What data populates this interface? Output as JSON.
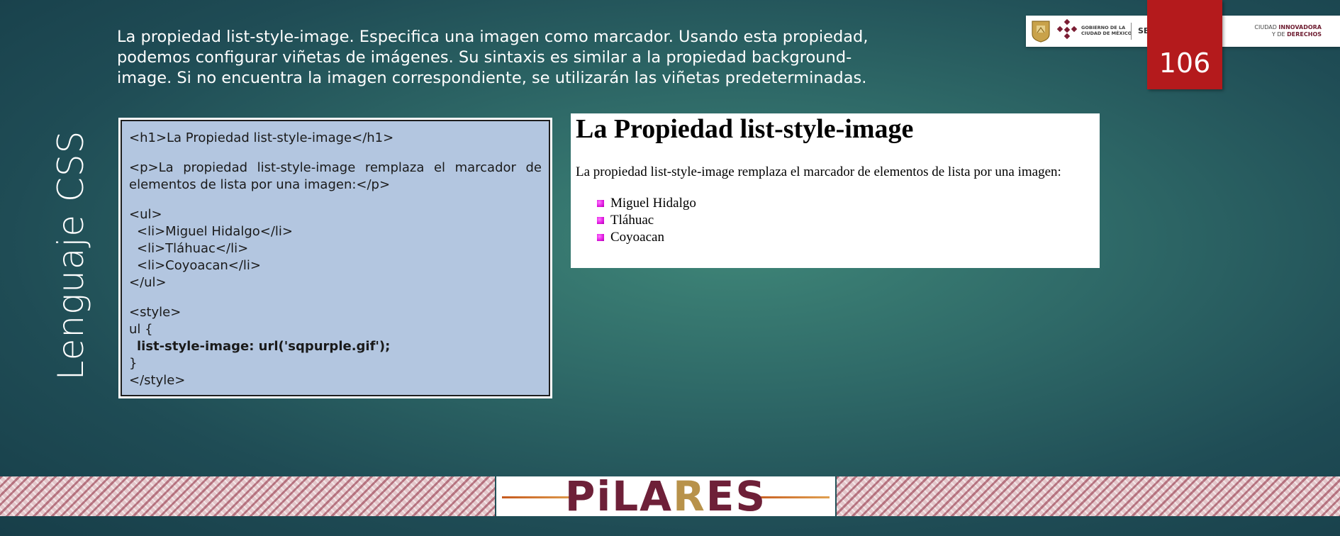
{
  "slide": {
    "title": "Lenguaje CSS",
    "intro": "La propiedad list-style-image. Especifica una imagen como marcador. Usando esta propiedad,  podemos configurar viñetas de imágenes. Su sintaxis es similar a la propiedad background-image. Si no encuentra la imagen correspondiente, se utilizarán las viñetas predeterminadas.",
    "page_number": "106"
  },
  "header_logos": {
    "gov_line1": "GOBIERNO DE LA",
    "gov_line2": "CIUDAD DE MÉXICO",
    "sectei": "SECTEI",
    "ciudad_line1_prefix": "CIUDAD ",
    "ciudad_line1_bold": "INNOVADORA",
    "ciudad_line2_prefix": "Y DE ",
    "ciudad_line2_bold": "DERECHOS"
  },
  "code": {
    "line1": "<h1>La Propiedad list-style-image</h1>",
    "line2": "<p>La propiedad list-style-image remplaza el marcador de elementos de lista por una imagen:</p>",
    "line3": "<ul>",
    "line4": "<li>Miguel Hidalgo</li>",
    "line5": "<li>Tláhuac</li>",
    "line6": "<li>Coyoacan</li>",
    "line7": "</ul>",
    "line8": "<style>",
    "line9": "ul {",
    "line10": "list-style-image: url('sqpurple.gif');",
    "line11": "}",
    "line12": "</style>"
  },
  "preview": {
    "heading": "La Propiedad list-style-image",
    "paragraph": "La propiedad list-style-image remplaza el marcador de elementos de lista por una imagen:",
    "items": [
      "Miguel Hidalgo",
      "Tláhuac",
      "Coyoacan"
    ]
  },
  "footer": {
    "logo_part1": "PiLA",
    "logo_part2": "R",
    "logo_part3": "ES"
  },
  "colors": {
    "page_tab": "#b41a1c",
    "code_bg": "#b3c6e0",
    "bullet": "#e31ee3",
    "brand_wine": "#6e2038",
    "brand_gold": "#b8924a"
  }
}
